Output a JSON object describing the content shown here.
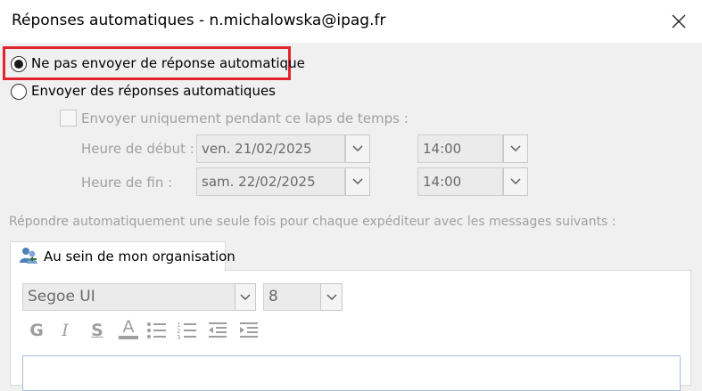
{
  "window": {
    "title": "Réponses automatiques - n.michalowska@ipag.fr",
    "close_icon": "close-icon"
  },
  "options": {
    "no_reply_label": "Ne pas envoyer de réponse automatique",
    "no_reply_selected": true,
    "send_reply_label": "Envoyer des réponses automatiques",
    "send_reply_selected": false,
    "time_range_label": "Envoyer uniquement pendant ce laps de temps :",
    "time_range_checked": false
  },
  "schedule": {
    "start_label": "Heure de début :",
    "start_date": "ven. 21/02/2025",
    "start_time": "14:00",
    "end_label": "Heure de fin :",
    "end_date": "sam. 22/02/2025",
    "end_time": "14:00"
  },
  "reply_once_label": "Répondre automatiquement une seule fois pour chaque expéditeur avec les messages suivants :",
  "tab": {
    "label": "Au sein de mon organisation",
    "icon": "people-icon"
  },
  "formatting": {
    "font_name": "Segoe UI",
    "font_size": "8",
    "bold_label": "G",
    "italic_label": "I",
    "underline_label": "S",
    "font_color_label": "A"
  },
  "colors": {
    "highlight": "#e0252c",
    "disabled_text": "#a0a0a0"
  }
}
